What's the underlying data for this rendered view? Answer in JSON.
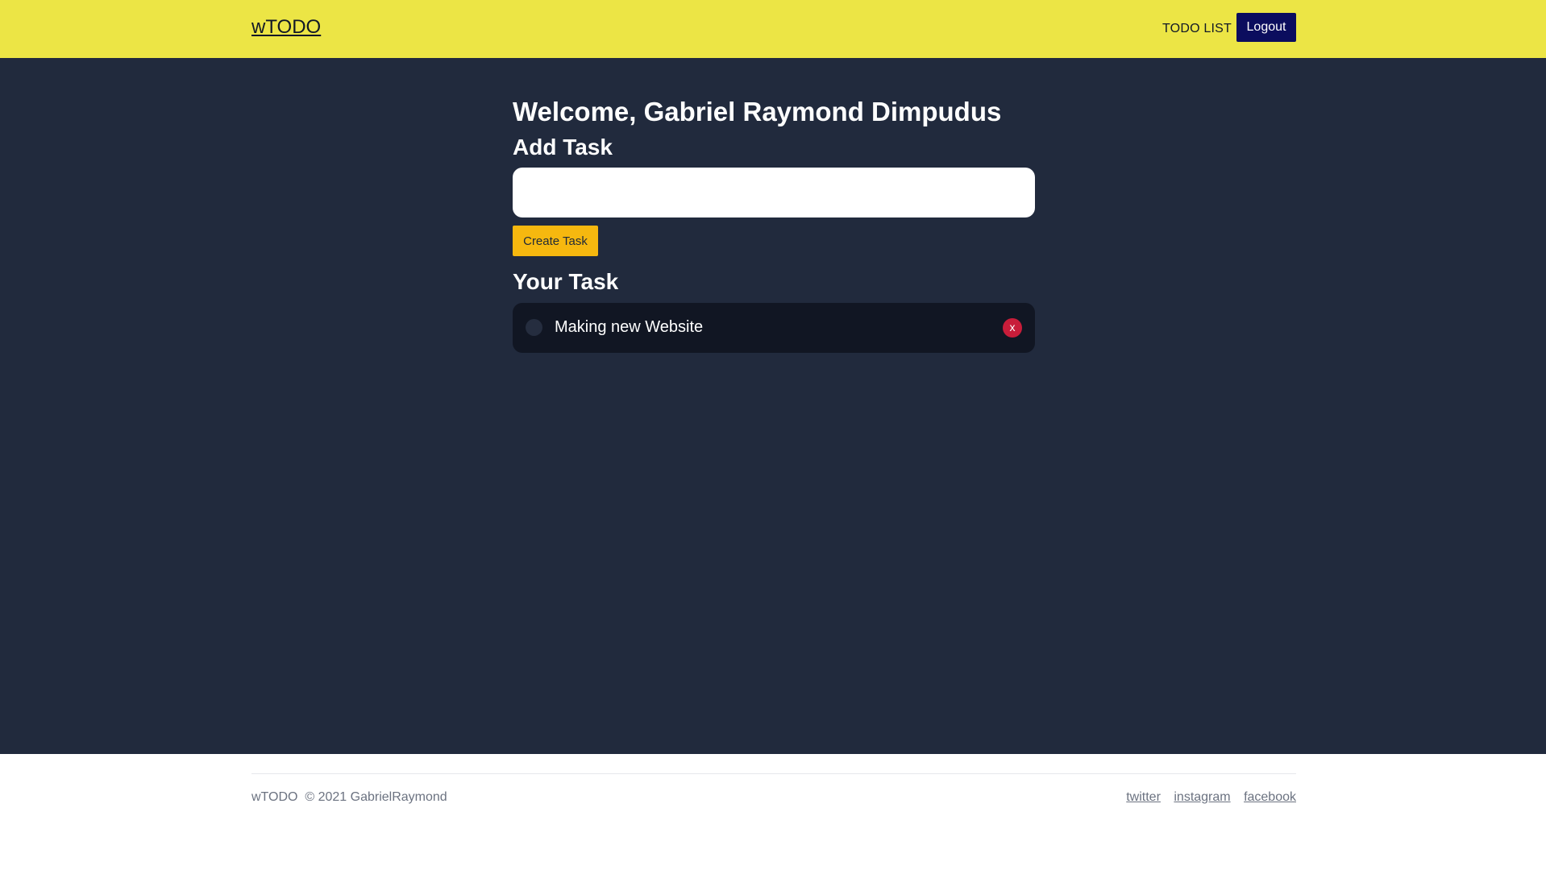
{
  "header": {
    "brand": "wTODO",
    "nav_link": "TODO LIST",
    "logout_label": "Logout"
  },
  "main": {
    "welcome": "Welcome, Gabriel Raymond Dimpudus",
    "add_title": "Add Task",
    "input_value": "",
    "create_label": "Create Task",
    "your_title": "Your Task",
    "tasks": [
      {
        "text": "Making new Website",
        "done": false,
        "delete_label": "x"
      }
    ]
  },
  "footer": {
    "brand": "wTODO",
    "copyright": "© 2021 GabrielRaymond",
    "links": [
      "twitter",
      "instagram",
      "facebook"
    ]
  },
  "colors": {
    "navbar": "#ece545",
    "main_bg": "#212a3d",
    "task_bg": "#111623",
    "logout": "#0b0d5e",
    "create": "#f6b80f",
    "delete": "#c81d3a"
  }
}
